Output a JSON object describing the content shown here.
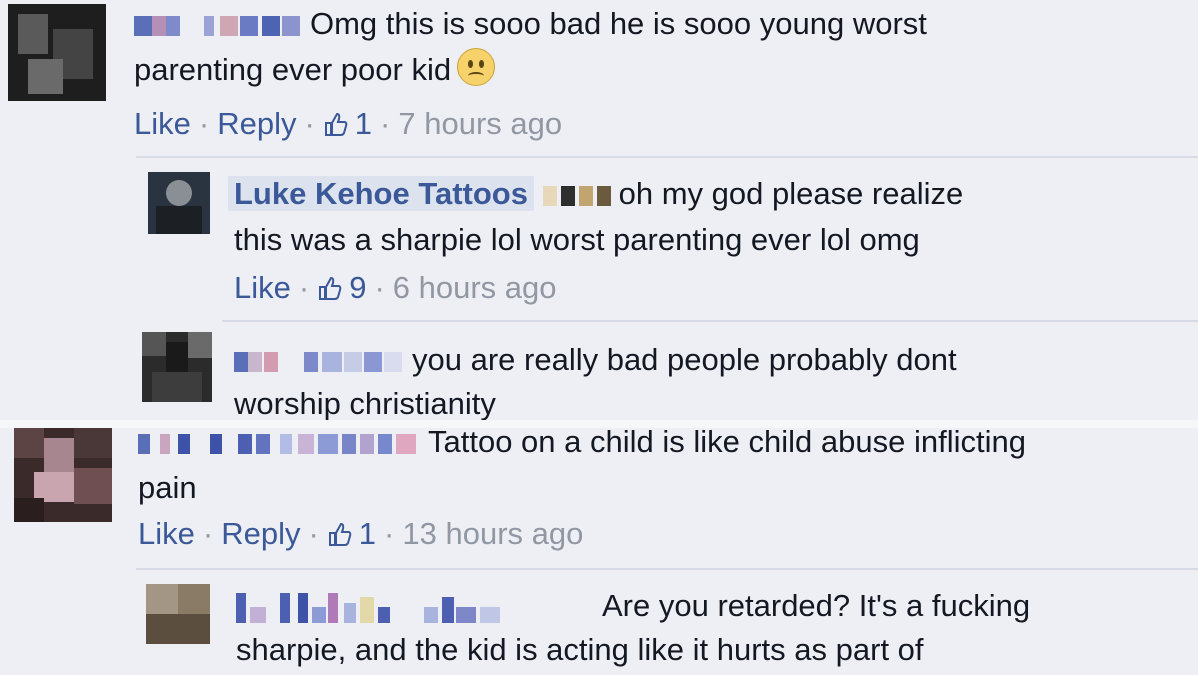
{
  "comments": [
    {
      "text_line1": "Omg this is sooo bad he is sooo young worst",
      "text_line2": "parenting ever poor kid",
      "emoji": "sad-face",
      "like_label": "Like",
      "reply_label": "Reply",
      "likes": "1",
      "time": "7 hours ago"
    },
    {
      "author": "Luke Kehoe Tattoos",
      "text_line1": "oh my god please realize",
      "text_line2": "this was a sharpie lol worst parenting ever lol omg",
      "like_label": "Like",
      "likes": "9",
      "time": "6 hours ago"
    },
    {
      "text_line1": "you are really bad people probably dont",
      "text_line2": "worship christianity"
    },
    {
      "text_line1": "Tattoo on a child is like child abuse inflicting",
      "text_line2": "pain",
      "like_label": "Like",
      "reply_label": "Reply",
      "likes": "1",
      "time": "13 hours ago"
    },
    {
      "text_line1": "Are you retarded? It's a fucking",
      "text_line2": "sharpie, and the kid is acting like it hurts as part of"
    }
  ],
  "colors": {
    "link": "#3b5998",
    "meta": "#9197a3",
    "background": "#edeff4"
  },
  "icons": {
    "thumbs_up": "thumbs-up-icon",
    "emoji": "sad-face-icon"
  }
}
